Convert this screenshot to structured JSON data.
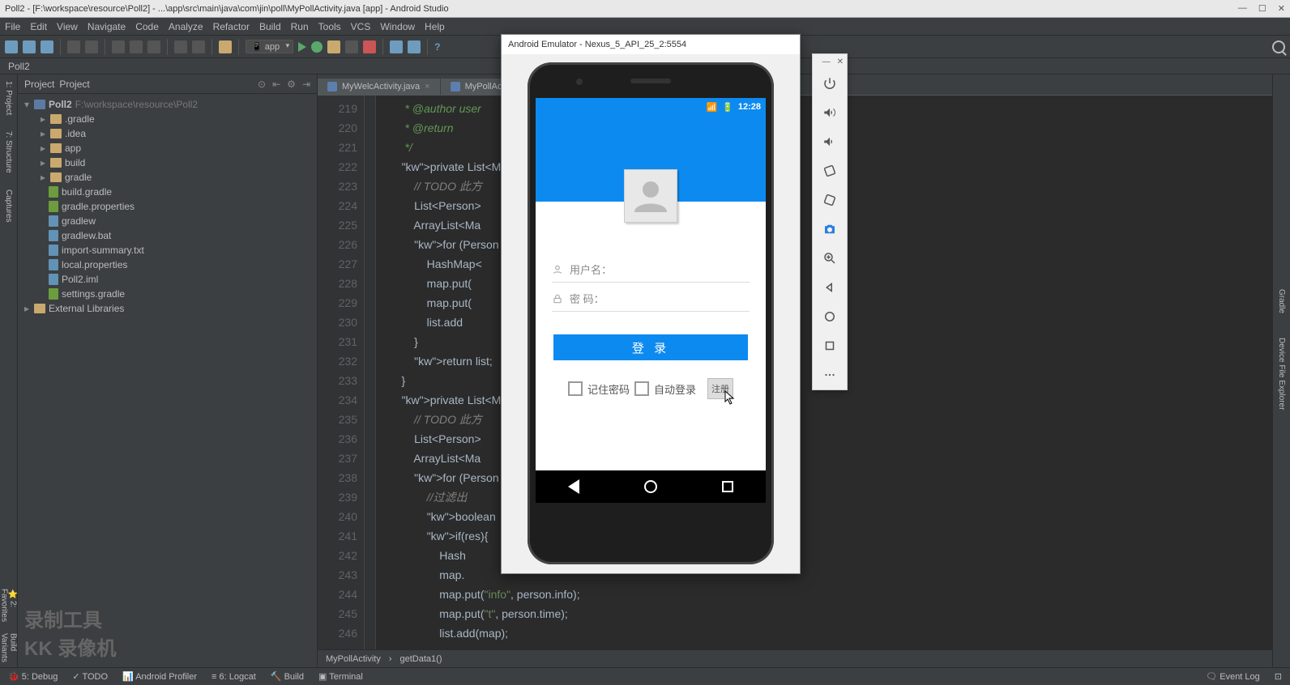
{
  "titlebar": {
    "text": "Poll2 - [F:\\workspace\\resource\\Poll2] - ...\\app\\src\\main\\java\\com\\jin\\poll\\MyPollActivity.java [app] - Android Studio"
  },
  "menu": [
    "File",
    "Edit",
    "View",
    "Navigate",
    "Code",
    "Analyze",
    "Refactor",
    "Build",
    "Run",
    "Tools",
    "VCS",
    "Window",
    "Help"
  ],
  "runconfig": "app",
  "projectStrip": "Poll2",
  "projectPanel": {
    "title": "Project"
  },
  "tree": {
    "root": {
      "name": "Poll2",
      "path": "F:\\workspace\\resource\\Poll2"
    },
    "items": [
      {
        "t": "f",
        "n": ".gradle",
        "d": 1
      },
      {
        "t": "f",
        "n": ".idea",
        "d": 1
      },
      {
        "t": "f",
        "n": "app",
        "d": 1
      },
      {
        "t": "f",
        "n": "build",
        "d": 1
      },
      {
        "t": "f",
        "n": "gradle",
        "d": 1
      },
      {
        "t": "g",
        "n": "build.gradle",
        "d": 1
      },
      {
        "t": "g",
        "n": "gradle.properties",
        "d": 1
      },
      {
        "t": "j",
        "n": "gradlew",
        "d": 1
      },
      {
        "t": "j",
        "n": "gradlew.bat",
        "d": 1
      },
      {
        "t": "j",
        "n": "import-summary.txt",
        "d": 1
      },
      {
        "t": "j",
        "n": "local.properties",
        "d": 1
      },
      {
        "t": "j",
        "n": "Poll2.iml",
        "d": 1
      },
      {
        "t": "g",
        "n": "settings.gradle",
        "d": 1
      }
    ],
    "libs": "External Libraries"
  },
  "watermark": {
    "l1": "录制工具",
    "l2": "KK 录像机"
  },
  "tabs": [
    {
      "label": "MyWelcActivity.java"
    },
    {
      "label": "MyPollActivity.java"
    }
  ],
  "lines": [
    "",
    "219",
    "220",
    "221",
    "222",
    "223",
    "224",
    "225",
    "226",
    "227",
    "228",
    "229",
    "230",
    "231",
    "232",
    "233",
    "234",
    "235",
    "236",
    "237",
    "238",
    "239",
    "240",
    "241",
    "242",
    "243",
    "244",
    "245",
    "246"
  ],
  "code": [
    "     * @author user",
    "     * @return",
    "     */",
    "    private List<Map",
    "        // TODO 此方",
    "        List<Person>",
    "        ArrayList<Ma",
    "        for (Person ",
    "            HashMap<",
    "            map.put(",
    "            map.put(",
    "            list.add",
    "        }",
    "        return list;",
    "    }",
    "",
    "    private List<Map",
    "        // TODO 此方",
    "        List<Person>",
    "        ArrayList<Ma                                           ring, String>>();",
    "        for (Person ",
    "            //过滤出",
    "            boolean ",
    "            if(res){",
    "                Hash",
    "                map.",
    "                map.put(\"info\", person.info);",
    "                map.put(\"t\", person.time);",
    "                list.add(map);"
  ],
  "breadcrumb": {
    "a": "MyPollActivity",
    "b": "getData1()"
  },
  "bottom": {
    "left": [
      "Debug",
      "TODO",
      "Android Profiler",
      "Logcat",
      "Build",
      "Terminal"
    ],
    "right": [
      "Event Log"
    ]
  },
  "emulator": {
    "title": "Android Emulator - Nexus_5_API_25_2:5554",
    "time": "12:28",
    "username_label": "用户名：",
    "password_label": "密  码：",
    "login_btn": "登 录",
    "remember": "记住密码",
    "autologin": "自动登录",
    "register": "注册"
  }
}
